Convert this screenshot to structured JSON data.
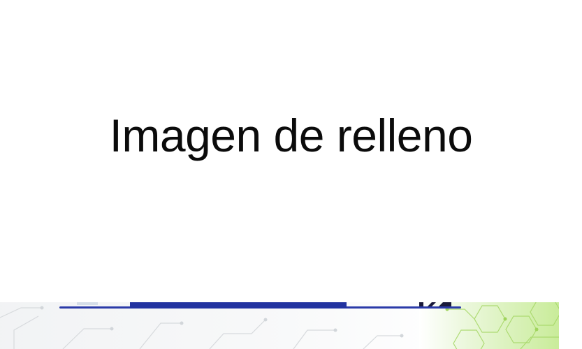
{
  "placeholder": {
    "text": "Imagen de relleno"
  },
  "background_graphic": {
    "icon": "circuit-pattern-icon",
    "bar_color": "#2233a0",
    "accent_color": "#c9ec9a"
  }
}
